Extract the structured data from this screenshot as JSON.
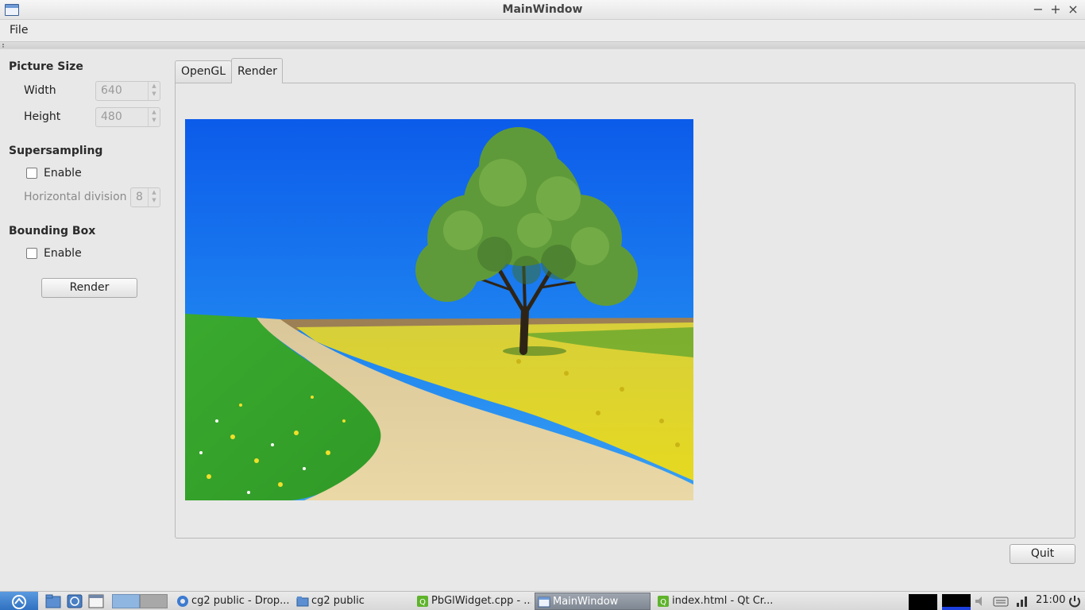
{
  "window": {
    "title": "MainWindow",
    "controls": {
      "minimize": "−",
      "maximize": "+",
      "close": "×"
    }
  },
  "menu": {
    "file": "File"
  },
  "panel": {
    "picture_size": {
      "title": "Picture Size",
      "width_label": "Width",
      "width_value": "640",
      "height_label": "Height",
      "height_value": "480"
    },
    "supersampling": {
      "title": "Supersampling",
      "enable_label": "Enable",
      "enabled": false,
      "horizontal_division_label": "Horizontal division",
      "horizontal_division_value": "8"
    },
    "bounding_box": {
      "title": "Bounding Box",
      "enable_label": "Enable",
      "enabled": false
    },
    "render_button": "Render"
  },
  "tabs": [
    {
      "label": "OpenGL",
      "active": false
    },
    {
      "label": "Render",
      "active": true
    }
  ],
  "quit_button": "Quit",
  "taskbar": {
    "tasks": [
      {
        "label": "cg2 public - Drop...",
        "icon": "chromium-icon",
        "active": false
      },
      {
        "label": "cg2 public",
        "icon": "folder-icon",
        "active": false
      },
      {
        "label": "PbGlWidget.cpp - ...",
        "icon": "qt-creator-icon",
        "active": false
      },
      {
        "label": "MainWindow",
        "icon": "window-icon",
        "active": true
      },
      {
        "label": "index.html - Qt Cr...",
        "icon": "qt-creator-icon",
        "active": false
      }
    ],
    "clock": "21:00"
  },
  "colors": {
    "sky": "#1565e8",
    "grass": "#3caa2e",
    "flowers": "#e8d825",
    "road": "#e2cf9c",
    "active_task": "#8a919b"
  }
}
